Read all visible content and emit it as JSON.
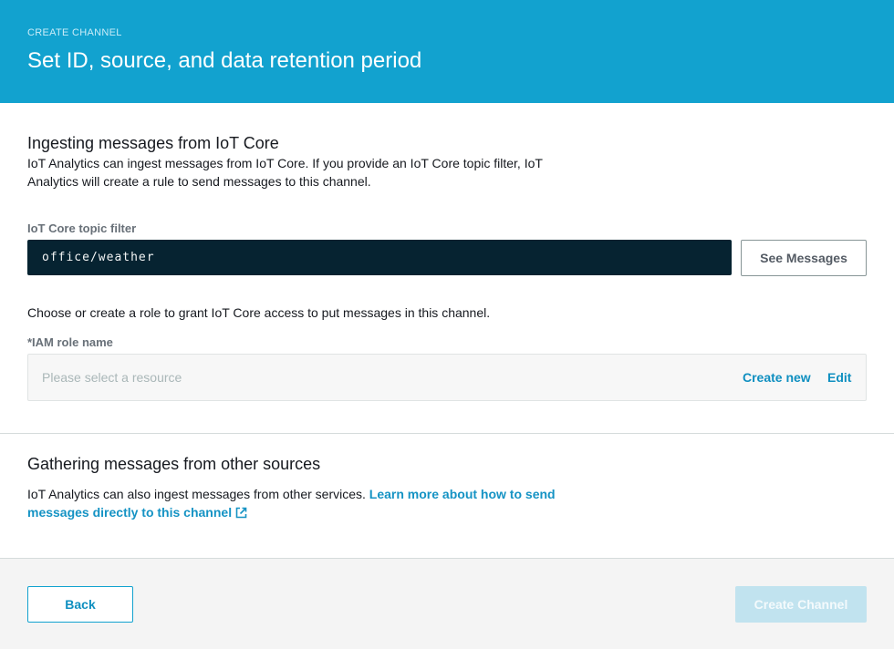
{
  "header": {
    "eyebrow": "CREATE CHANNEL",
    "title": "Set ID, source, and data retention period"
  },
  "iot_core": {
    "title": "Ingesting messages from IoT Core",
    "description": "IoT Analytics can ingest messages from IoT Core. If you provide an IoT Core topic filter, IoT Analytics will create a rule to send messages to this channel.",
    "topic_label": "IoT Core topic filter",
    "topic_value": "office/weather",
    "see_messages_label": "See Messages",
    "role_hint": "Choose or create a role to grant IoT Core access to put messages in this channel.",
    "role_label": "*IAM role name",
    "role_placeholder": "Please select a resource",
    "create_new_label": "Create new",
    "edit_label": "Edit"
  },
  "other_sources": {
    "title": "Gathering messages from other sources",
    "description": "IoT Analytics can also ingest messages from other services.",
    "link_text": "Learn more about how to send messages directly to this channel"
  },
  "footer": {
    "back_label": "Back",
    "create_label": "Create Channel"
  },
  "colors": {
    "header_bg": "#12a2cf",
    "input_dark_bg": "#062331",
    "link": "#0f8fc0",
    "disabled_primary": "#c1e3ef"
  },
  "icons": [
    "external-link-icon"
  ]
}
